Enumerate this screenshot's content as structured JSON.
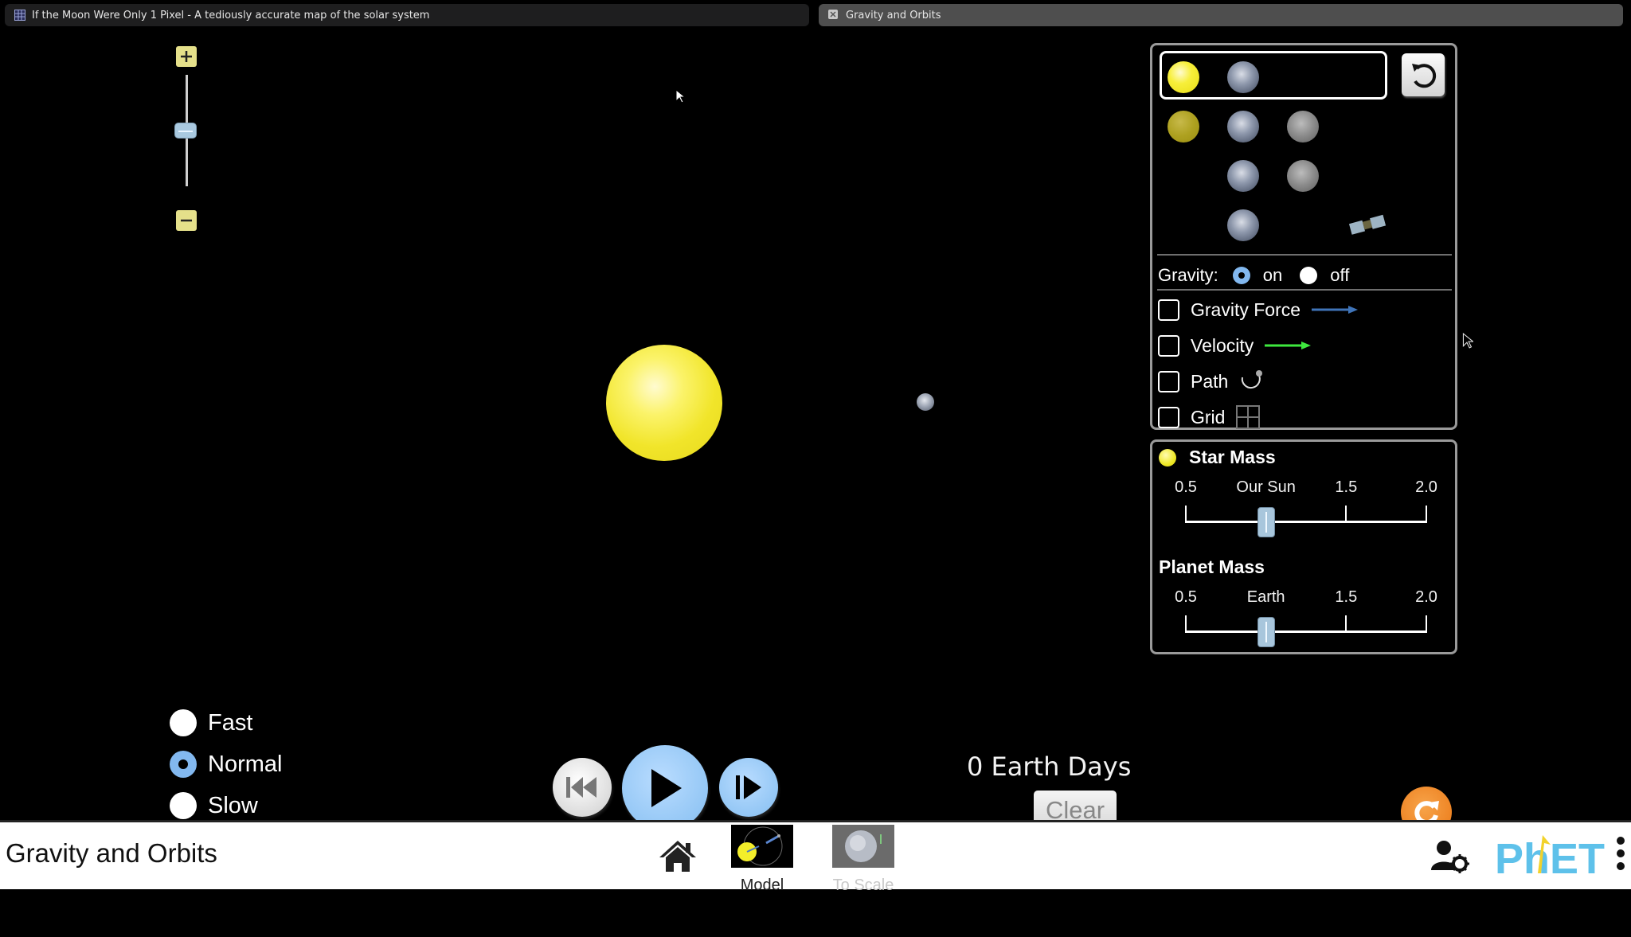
{
  "browser": {
    "tabs": [
      {
        "label": "If the Moon Were Only 1 Pixel - A tediously accurate map of the solar system",
        "icon": "grid-icon",
        "active": false
      },
      {
        "label": "Gravity and Orbits",
        "icon": "close-icon",
        "active": true
      }
    ]
  },
  "sim": {
    "zoom": {
      "plus_icon": "plus-icon",
      "minus_icon": "minus-icon",
      "level_fraction": 0.4
    },
    "bodies": [
      {
        "name": "star",
        "color": "#f1e52a"
      },
      {
        "name": "planet",
        "color": "#9ea6b5"
      }
    ],
    "body_selector": {
      "rows": [
        {
          "icons": [
            "sun",
            "earth"
          ],
          "selected": true
        },
        {
          "icons": [
            "sun",
            "earth",
            "moon"
          ],
          "selected": false
        },
        {
          "icons": [
            "earth",
            "moon"
          ],
          "selected": false
        },
        {
          "icons": [
            "earth",
            "satellite"
          ],
          "selected": false
        }
      ],
      "reset_icon": "undo-icon"
    },
    "gravity": {
      "label": "Gravity:",
      "on_label": "on",
      "off_label": "off",
      "selected": "on"
    },
    "checkboxes": [
      {
        "label": "Gravity Force",
        "checked": false,
        "icon": "blue-arrow-icon",
        "color": "#3f74b8"
      },
      {
        "label": "Velocity",
        "checked": false,
        "icon": "green-arrow-icon",
        "color": "#3ee83e"
      },
      {
        "label": "Path",
        "checked": false,
        "icon": "path-icon"
      },
      {
        "label": "Grid",
        "checked": false,
        "icon": "grid-icon"
      }
    ],
    "star_mass": {
      "title": "Star Mass",
      "ticks": [
        "0.5",
        "Our Sun",
        "1.5",
        "2.0"
      ],
      "min": 0.5,
      "max": 2.0,
      "value": 1.0
    },
    "planet_mass": {
      "title": "Planet Mass",
      "ticks": [
        "0.5",
        "Earth",
        "1.5",
        "2.0"
      ],
      "min": 0.5,
      "max": 2.0,
      "value": 1.0
    },
    "speed": {
      "options": [
        "Fast",
        "Normal",
        "Slow"
      ],
      "selected": "Normal"
    },
    "playback": {
      "rewind_icon": "rewind-icon",
      "play_icon": "play-icon",
      "step_icon": "step-forward-icon"
    },
    "elapsed": "0 Earth Days",
    "clear_label": "Clear",
    "reset_all_icon": "reset-all-icon"
  },
  "navbar": {
    "title": "Gravity and Orbits",
    "screens": [
      {
        "label": "Model",
        "selected": true
      },
      {
        "label": "To Scale",
        "selected": false
      }
    ],
    "brand": "PhET"
  }
}
